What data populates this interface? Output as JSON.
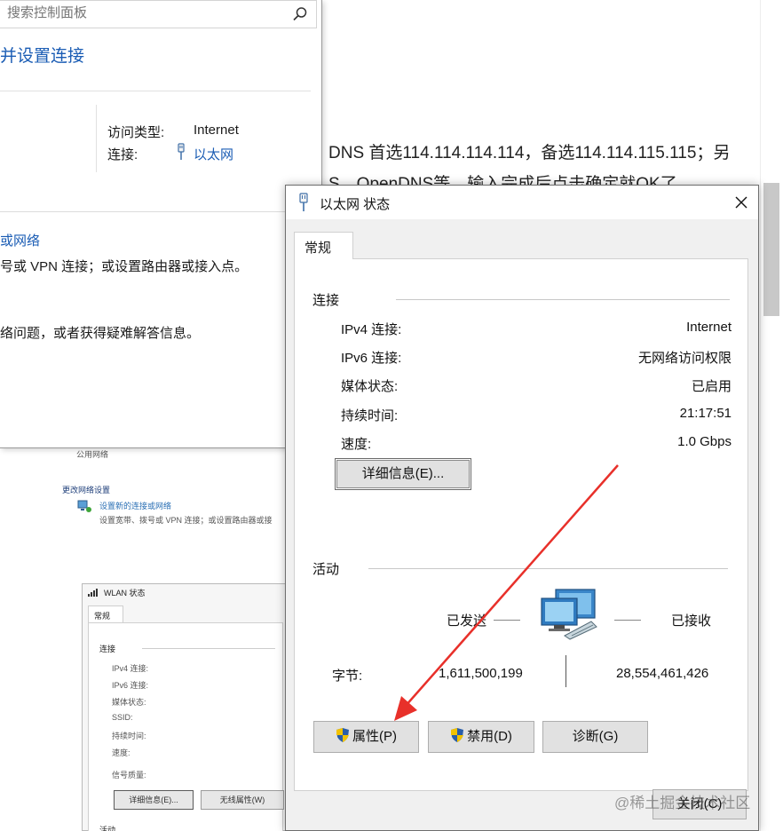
{
  "article": {
    "line1": "DNS 首选114.114.114.114，备选114.114.115.115；另",
    "line2": "S、OpenDNS等，输入完成后点击确定就OK了。"
  },
  "control_panel": {
    "search_placeholder": "搜索控制面板",
    "heading": "并设置连接",
    "access_type_label": "访问类型:",
    "access_type_value": "Internet",
    "connection_label": "连接:",
    "connection_value": "以太网",
    "setup_link": "或网络",
    "setup_desc": "号或 VPN 连接；或设置路由器或接入点。",
    "troubleshoot_desc": "络问题，或者获得疑难解答信息。"
  },
  "bg_screenshot": {
    "public_network": "公用网络",
    "change_settings": "更改网络设置",
    "new_connection_link": "设置新的连接或网络",
    "new_connection_desc": "设置宽带、拨号或 VPN 连接；或设置路由器或接",
    "wlan": {
      "title": "WLAN 状态",
      "tab": "常规",
      "group": "连接",
      "rows": [
        "IPv4 连接:",
        "IPv6 连接:",
        "媒体状态:",
        "SSID:",
        "持续时间:",
        "速度:",
        "信号质量:"
      ],
      "details_button": "详细信息(E)...",
      "wireless_button": "无线属性(W)",
      "activity": "活动"
    }
  },
  "dialog": {
    "title": "以太网 状态",
    "close_icon": "close-icon",
    "tab_general": "常规",
    "connection_group": "连接",
    "rows": [
      {
        "label": "IPv4 连接:",
        "value": "Internet"
      },
      {
        "label": "IPv6 连接:",
        "value": "无网络访问权限"
      },
      {
        "label": "媒体状态:",
        "value": "已启用"
      },
      {
        "label": "持续时间:",
        "value": "21:17:51"
      },
      {
        "label": "速度:",
        "value": "1.0 Gbps"
      }
    ],
    "details_button": "详细信息(E)...",
    "activity_group": "活动",
    "sent_label": "已发送",
    "received_label": "已接收",
    "bytes_label": "字节:",
    "bytes_sent": "1,611,500,199",
    "bytes_received": "28,554,461,426",
    "properties_button": "属性(P)",
    "disable_button": "禁用(D)",
    "diagnose_button": "诊断(G)",
    "close_button": "关闭(C)"
  },
  "watermark": "@稀土掘金技术社区",
  "colors": {
    "link": "#1a5cb4",
    "annotation_arrow": "#e8302a",
    "shield_blue": "#2a5ea8",
    "shield_yellow": "#f2c200"
  }
}
